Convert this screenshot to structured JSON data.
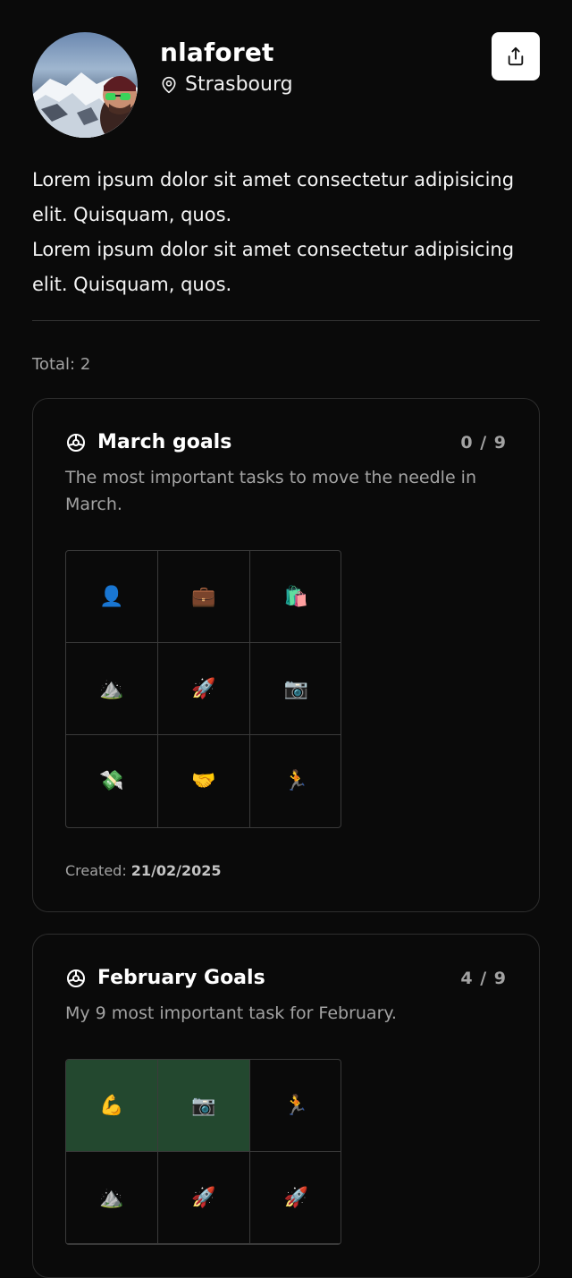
{
  "profile": {
    "username": "nlaforet",
    "location": "Strasbourg",
    "share_icon": "share-icon",
    "pin_icon": "map-pin-icon"
  },
  "bio": {
    "lines": [
      "Lorem ipsum dolor sit amet consectetur adipisicing elit. Quisquam, quos.",
      "Lorem ipsum dolor sit amet consectetur adipisicing elit. Quisquam, quos."
    ]
  },
  "total_label": "Total: 2",
  "cards": [
    {
      "title": "March goals",
      "count": "0 / 9",
      "description": "The most important tasks to move the needle in March.",
      "created_prefix": "Created: ",
      "created_date": "21/02/2025",
      "cells": [
        {
          "emoji": "👤",
          "done": false
        },
        {
          "emoji": "💼",
          "done": false
        },
        {
          "emoji": "🛍️",
          "done": false
        },
        {
          "emoji": "⛰️",
          "done": false
        },
        {
          "emoji": "🚀",
          "done": false
        },
        {
          "emoji": "📷",
          "done": false
        },
        {
          "emoji": "💸",
          "done": false
        },
        {
          "emoji": "🤝",
          "done": false
        },
        {
          "emoji": "🏃",
          "done": false
        }
      ]
    },
    {
      "title": "February Goals",
      "count": "4 / 9",
      "description": "My 9 most important task for February.",
      "cells": [
        {
          "emoji": "💪",
          "done": true
        },
        {
          "emoji": "📷",
          "done": true
        },
        {
          "emoji": "🏃",
          "done": false
        },
        {
          "emoji": "⛰️",
          "done": false
        },
        {
          "emoji": "🚀",
          "done": false
        },
        {
          "emoji": "🚀",
          "done": false
        }
      ]
    }
  ],
  "colors": {
    "background": "#0a0a0a",
    "done_cell": "#23482f",
    "muted_text": "#a3a3a3"
  }
}
